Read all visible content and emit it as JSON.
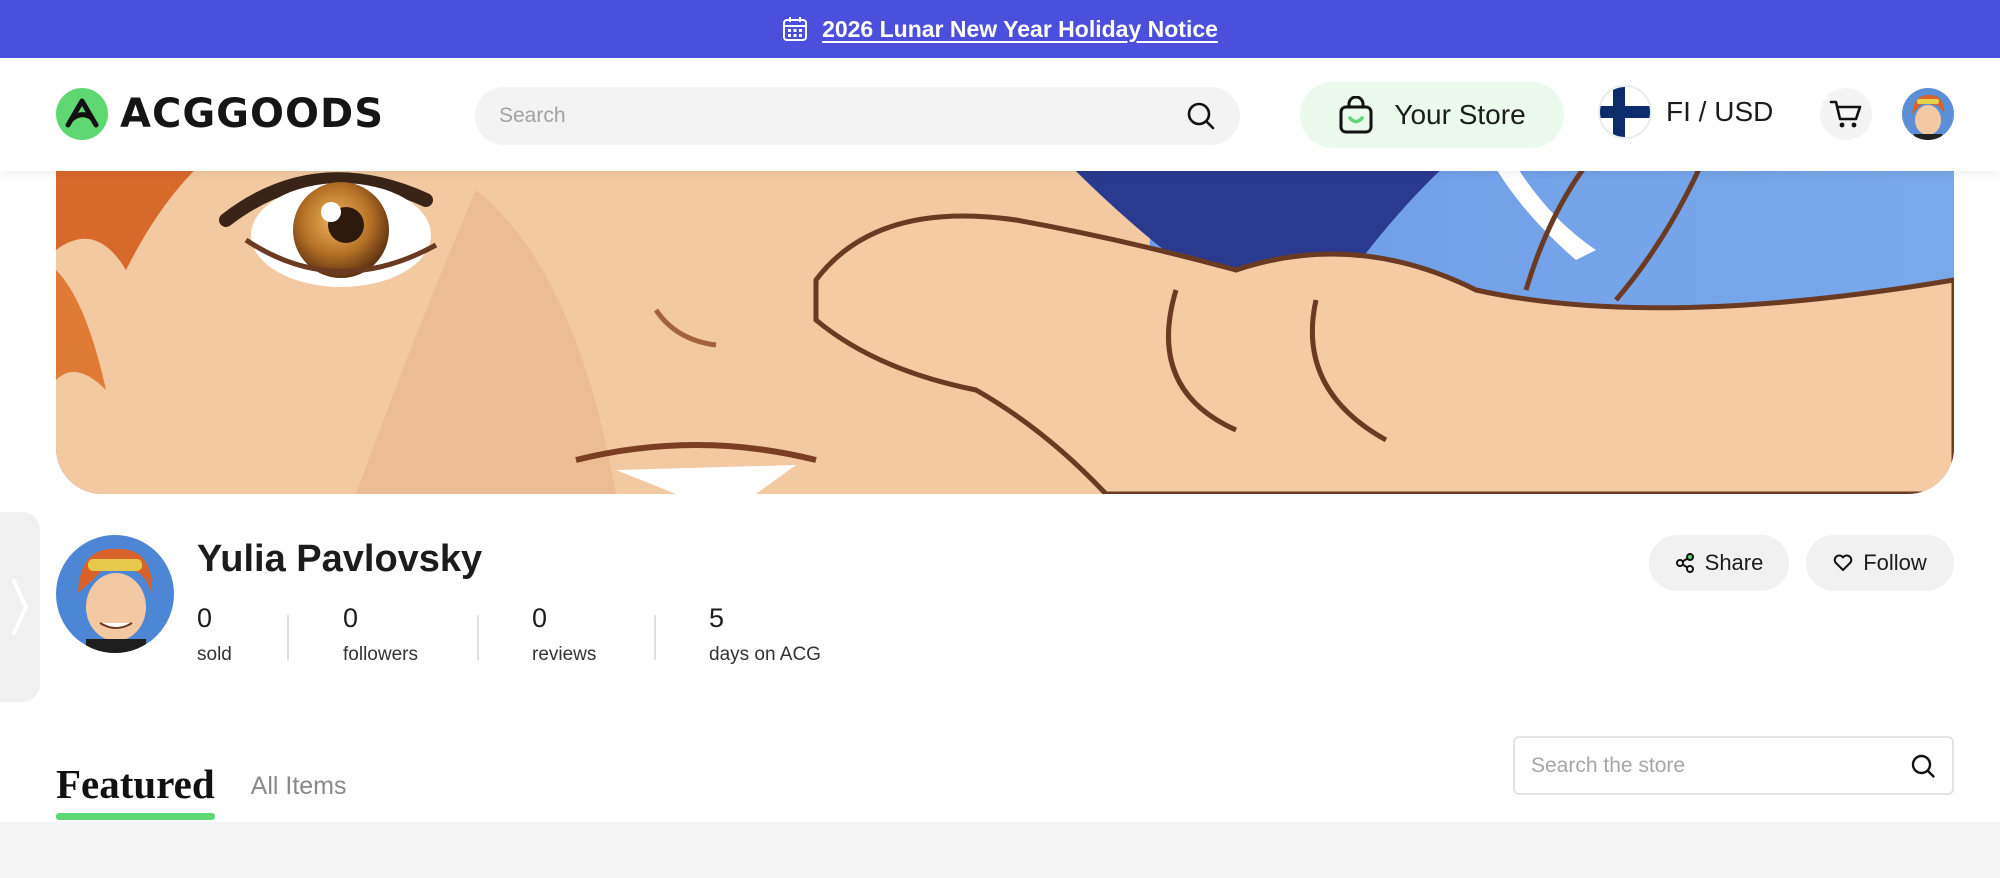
{
  "announcement": {
    "text": "2026 Lunar New Year Holiday Notice",
    "icon": "calendar-icon"
  },
  "header": {
    "brand": "ACGGOODS",
    "search_placeholder": "Search",
    "your_store_label": "Your Store",
    "locale_label": "FI / USD",
    "flag": "finland-flag"
  },
  "profile": {
    "name": "Yulia Pavlovsky",
    "stats": [
      {
        "value": "0",
        "label": "sold"
      },
      {
        "value": "0",
        "label": "followers"
      },
      {
        "value": "0",
        "label": "reviews"
      },
      {
        "value": "5",
        "label": "days on ACG"
      }
    ],
    "share_label": "Share",
    "follow_label": "Follow"
  },
  "tabs": [
    {
      "label": "Featured",
      "active": true
    },
    {
      "label": "All Items",
      "active": false
    }
  ],
  "store_search_placeholder": "Search the store",
  "colors": {
    "announce_bg": "#4a4fdc",
    "accent_green": "#5fd874"
  }
}
